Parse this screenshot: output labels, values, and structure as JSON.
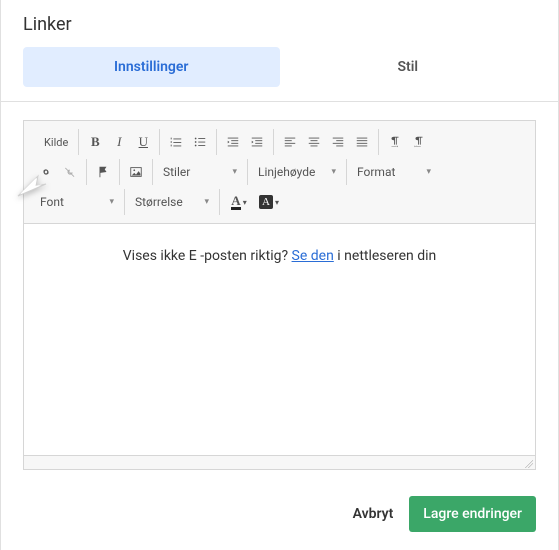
{
  "header": {
    "title": "Linker"
  },
  "tabs": {
    "settings": "Innstillinger",
    "style": "Stil"
  },
  "toolbar": {
    "source": "Kilde",
    "styles": "Stiler",
    "lineheight": "Linjehøyde",
    "format": "Format",
    "font": "Font",
    "size": "Størrelse",
    "txtcolor": "A",
    "bgcolor": "A"
  },
  "content": {
    "prefix": "Vises ikke E -posten riktig? ",
    "link": "Se den",
    "suffix": " i nettleseren din"
  },
  "footer": {
    "cancel": "Avbryt",
    "save": "Lagre endringer"
  }
}
